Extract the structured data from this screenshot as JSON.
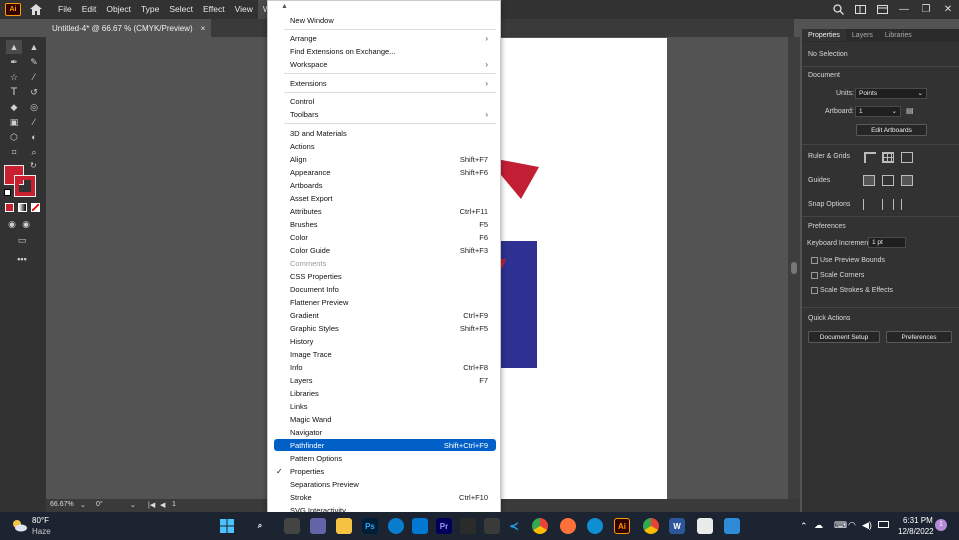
{
  "app": {
    "logo": "Ai",
    "home_icon": "home-icon"
  },
  "menubar": {
    "items": [
      "File",
      "Edit",
      "Object",
      "Type",
      "Select",
      "Effect",
      "View",
      "Window"
    ],
    "active_index": 7
  },
  "document_tab": {
    "title": "Untitled-4* @ 66.67 % (CMYK/Preview)",
    "close": "×"
  },
  "status_bar": {
    "zoom": "66.67%",
    "rotation": "0°",
    "artboard_num": "1"
  },
  "window_menu": {
    "items": [
      {
        "label": "New Window",
        "shortcut": ""
      },
      {
        "label": "Arrange",
        "shortcut": "",
        "submenu": true
      },
      {
        "label": "Find Extensions on Exchange...",
        "shortcut": ""
      },
      {
        "label": "Workspace",
        "shortcut": "",
        "submenu": true
      },
      {
        "label": "Extensions",
        "shortcut": "",
        "submenu": true
      },
      {
        "label": "Control",
        "shortcut": ""
      },
      {
        "label": "Toolbars",
        "shortcut": "",
        "submenu": true
      },
      {
        "label": "3D and Materials",
        "shortcut": ""
      },
      {
        "label": "Actions",
        "shortcut": ""
      },
      {
        "label": "Align",
        "shortcut": "Shift+F7"
      },
      {
        "label": "Appearance",
        "shortcut": "Shift+F6"
      },
      {
        "label": "Artboards",
        "shortcut": ""
      },
      {
        "label": "Asset Export",
        "shortcut": ""
      },
      {
        "label": "Attributes",
        "shortcut": "Ctrl+F11"
      },
      {
        "label": "Brushes",
        "shortcut": "F5"
      },
      {
        "label": "Color",
        "shortcut": "F6"
      },
      {
        "label": "Color Guide",
        "shortcut": "Shift+F3"
      },
      {
        "label": "Comments",
        "shortcut": "",
        "disabled": true
      },
      {
        "label": "CSS Properties",
        "shortcut": ""
      },
      {
        "label": "Document Info",
        "shortcut": ""
      },
      {
        "label": "Flattener Preview",
        "shortcut": ""
      },
      {
        "label": "Gradient",
        "shortcut": "Ctrl+F9"
      },
      {
        "label": "Graphic Styles",
        "shortcut": "Shift+F5"
      },
      {
        "label": "History",
        "shortcut": ""
      },
      {
        "label": "Image Trace",
        "shortcut": ""
      },
      {
        "label": "Info",
        "shortcut": "Ctrl+F8"
      },
      {
        "label": "Layers",
        "shortcut": "F7"
      },
      {
        "label": "Libraries",
        "shortcut": ""
      },
      {
        "label": "Links",
        "shortcut": ""
      },
      {
        "label": "Magic Wand",
        "shortcut": ""
      },
      {
        "label": "Navigator",
        "shortcut": ""
      },
      {
        "label": "Pathfinder",
        "shortcut": "Shift+Ctrl+F9",
        "highlighted": true
      },
      {
        "label": "Pattern Options",
        "shortcut": ""
      },
      {
        "label": "Properties",
        "shortcut": "",
        "checked": true
      },
      {
        "label": "Separations Preview",
        "shortcut": ""
      },
      {
        "label": "Stroke",
        "shortcut": "Ctrl+F10"
      },
      {
        "label": "SVG Interactivity",
        "shortcut": ""
      }
    ]
  },
  "panel": {
    "tabs": [
      "Properties",
      "Layers",
      "Libraries"
    ],
    "no_selection": "No Selection",
    "document_heading": "Document",
    "units_label": "Units:",
    "units_value": "Points",
    "artboard_label": "Artboard:",
    "artboard_value": "1",
    "edit_artboards": "Edit Artboards",
    "ruler_grids": "Ruler & Grids",
    "guides": "Guides",
    "snap_options": "Snap Options",
    "preferences_heading": "Preferences",
    "keyboard_increment_label": "Keyboard Increment:",
    "keyboard_increment_value": "1 pt",
    "use_preview_bounds": "Use Preview Bounds",
    "scale_corners": "Scale Corners",
    "scale_strokes": "Scale Strokes & Effects",
    "quick_actions": "Quick Actions",
    "document_setup": "Document Setup",
    "preferences_button": "Preferences"
  },
  "taskbar": {
    "weather_temp": "80°F",
    "weather_desc": "Haze",
    "time": "6:31 PM",
    "date": "12/8/2022",
    "notification_count": "1"
  },
  "colors": {
    "fill": "#c8202f",
    "shape_red": "#c21f35",
    "shape_blue": "#2e3192",
    "highlight": "#0060c8"
  }
}
